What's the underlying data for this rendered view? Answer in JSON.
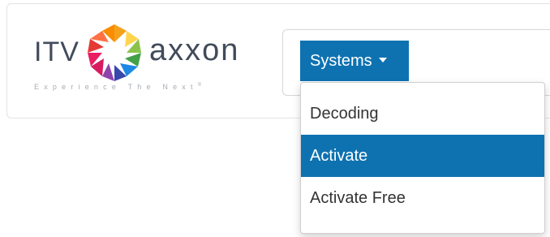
{
  "logo": {
    "brand_prefix": "ITV",
    "brand_name": "axxon",
    "tagline": "Experience The Next",
    "tagline_mark": "®",
    "colors": [
      "#e53935",
      "#f4a21c",
      "#8bc34a",
      "#1e88e5",
      "#8e44ad",
      "#e91e63"
    ]
  },
  "nav": {
    "systems_label": "Systems",
    "accent_color": "#0e72b1"
  },
  "dropdown": {
    "items": [
      {
        "label": "Decoding",
        "active": false
      },
      {
        "label": "Activate",
        "active": true
      },
      {
        "label": "Activate Free",
        "active": false
      }
    ]
  }
}
